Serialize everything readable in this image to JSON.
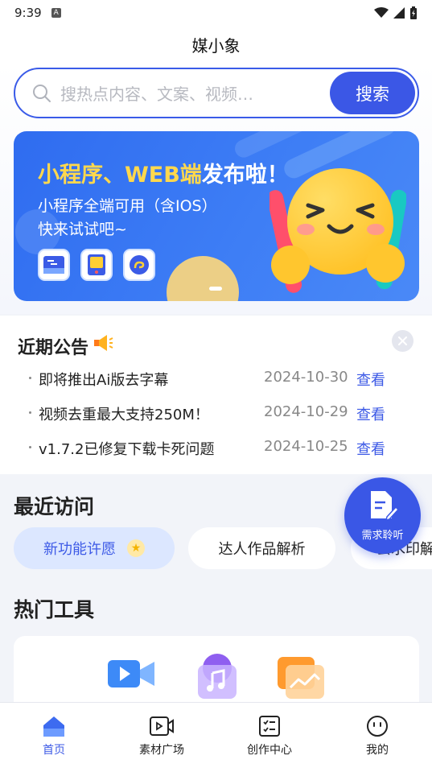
{
  "status": {
    "time": "9:39",
    "notification_icon": "A"
  },
  "header": {
    "title": "媒小象"
  },
  "search": {
    "placeholder": "搜热点内容、文案、视频…",
    "button_label": "搜索"
  },
  "banner": {
    "title_part1": "小程序、",
    "title_highlight": "WEB端",
    "title_part2": "发布啦！",
    "subtitle_line1": "小程序全端可用（含IOS）",
    "subtitle_line2": "快来试试吧~",
    "active_slide": 1
  },
  "notice": {
    "title": "近期公告",
    "items": [
      {
        "text": "即将推出Ai版去字幕",
        "date": "2024-10-30",
        "action": "查看"
      },
      {
        "text": "视频去重最大支持250M！",
        "date": "2024-10-29",
        "action": "查看"
      },
      {
        "text": "v1.7.2已修复下载卡死问题",
        "date": "2024-10-25",
        "action": "查看"
      }
    ]
  },
  "recent": {
    "title": "最近访问",
    "chips": [
      "新功能许愿",
      "达人作品解析",
      "去水印解析"
    ]
  },
  "fab": {
    "label": "需求聆听"
  },
  "hot_tools": {
    "title": "热门工具"
  },
  "tabbar": {
    "items": [
      {
        "label": "首页",
        "icon": "home-icon"
      },
      {
        "label": "素材广场",
        "icon": "video-icon"
      },
      {
        "label": "创作中心",
        "icon": "checklist-icon"
      },
      {
        "label": "我的",
        "icon": "smile-icon"
      }
    ]
  },
  "colors": {
    "accent": "#3b57e6",
    "banner_bg": "#3a78f2",
    "highlight": "#ffd84d"
  }
}
